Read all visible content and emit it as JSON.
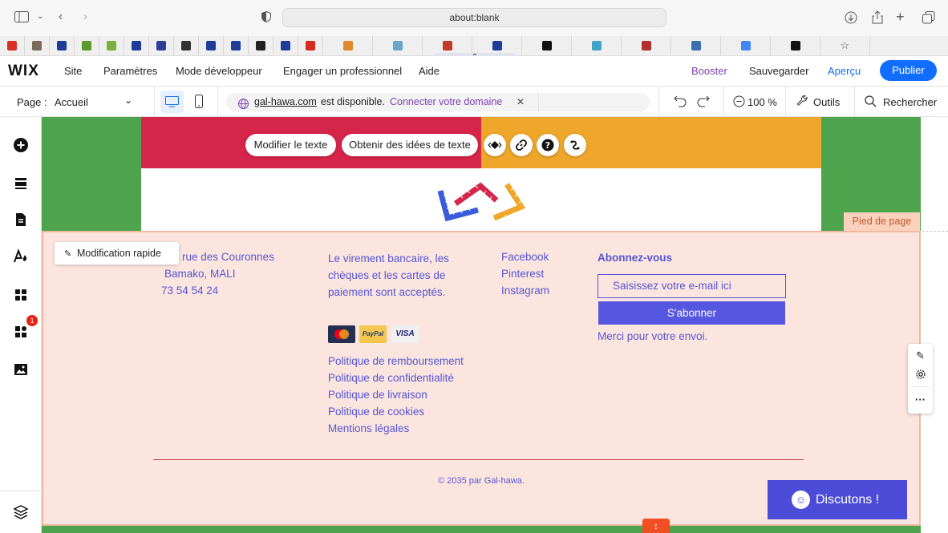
{
  "browser": {
    "url": "about:blank"
  },
  "bookmarks": [
    {
      "icon": "gmail-icon",
      "color": "#d93025"
    },
    {
      "icon": "grid-icon",
      "color": "#7a6a5a"
    },
    {
      "icon": "flag-fr-icon",
      "color": "#1f3c99"
    },
    {
      "icon": "green-square-icon",
      "color": "#5a9a2a"
    },
    {
      "icon": "leaf-icon",
      "color": "#7ab03a"
    },
    {
      "icon": "flag-fr-icon",
      "color": "#1f3c99"
    },
    {
      "icon": "square-blue-icon",
      "color": "#2e3f99"
    },
    {
      "icon": "person-icon",
      "color": "#333333"
    },
    {
      "icon": "flag-fr-icon",
      "color": "#1f3c99"
    },
    {
      "icon": "flag-fr-icon",
      "color": "#1f3c99"
    },
    {
      "icon": "frame-icon",
      "color": "#222222"
    },
    {
      "icon": "flag-fr-icon",
      "color": "#1f3c99"
    },
    {
      "icon": "swiss-cross-icon",
      "color": "#d52b1e"
    },
    {
      "icon": "moon-icon",
      "color": "#e08a2b"
    },
    {
      "icon": "moon-icon",
      "color": "#6aa6c9"
    },
    {
      "icon": "frame-icon",
      "color": "#c0392b"
    },
    {
      "icon": "flag-fr-icon",
      "color": "#1f3c99"
    },
    {
      "icon": "apple-icon",
      "color": "#111111"
    },
    {
      "icon": "circle-icon",
      "color": "#3fa5c8"
    },
    {
      "icon": "doc-icon",
      "color": "#b03030"
    },
    {
      "icon": "image-icon",
      "color": "#3d6fb0"
    },
    {
      "icon": "google-icon",
      "color": "#4285f4"
    },
    {
      "icon": "hd-icon",
      "color": "#111111"
    },
    {
      "icon": "star-icon",
      "color": "#555555"
    }
  ],
  "topbar": {
    "logo": "WIX",
    "menu": [
      "Site",
      "Paramètres",
      "Mode développeur",
      "Engager un professionnel",
      "Aide"
    ],
    "booster": "Booster",
    "save": "Sauvegarder",
    "preview": "Aperçu",
    "publish": "Publier",
    "accent": "#116dff"
  },
  "subbar": {
    "page_label": "Page :",
    "page_value": "Accueil",
    "domain": "gal-hawa.com",
    "domain_available": "est disponible.",
    "connect_domain": "Connecter votre domaine",
    "zoom": "100 %",
    "tools": "Outils",
    "search": "Rechercher"
  },
  "sidebar": {
    "badge_count": "1",
    "items": [
      "add-icon",
      "sections-icon",
      "pages-icon",
      "design-icon",
      "apps-icon",
      "business-icon",
      "media-icon",
      "layers-icon"
    ]
  },
  "canvas": {
    "edit_text": "Modifier le texte",
    "text_ideas": "Obtenir des idées de texte",
    "footer_tag": "Pied de page",
    "quick_edit": "Modification rapide",
    "address": [
      "rue des Couronnes",
      "Bamako, MALI",
      "73 54 54 24"
    ],
    "payment_note": [
      "Le virement bancaire, les",
      "chèques et les cartes de",
      "paiement sont acceptés."
    ],
    "payment_cards": [
      "MasterCard",
      "PayPal",
      "VISA"
    ],
    "policies": [
      "Politique de remboursement",
      "Politique de confidentialité",
      "Politique de livraison",
      "Politique de cookies",
      "Mentions légales"
    ],
    "social": [
      "Facebook",
      "Pinterest",
      "Instagram"
    ],
    "subscribe_title": "Abonnez-vous",
    "email_placeholder": "Saisissez votre e-mail ici",
    "subscribe_button": "S'abonner",
    "thanks": "Merci pour votre envoi.",
    "copyright": "© 2035 par Gal-hawa.",
    "chat": "Discutons !",
    "colors": {
      "green": "#4da44d",
      "red": "#d6254a",
      "orange": "#eea72b",
      "footer_bg": "#fbe5de",
      "link": "#5656d6"
    }
  }
}
